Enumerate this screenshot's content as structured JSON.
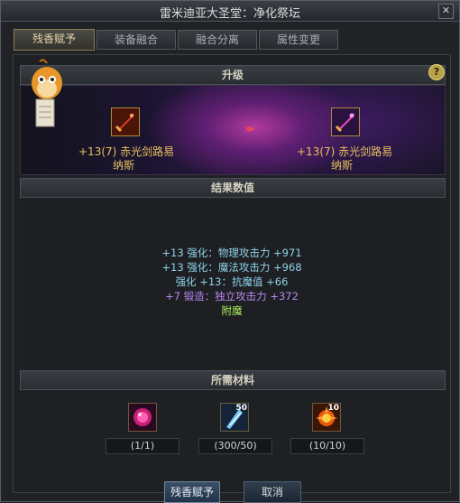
{
  "window": {
    "title": "雷米迪亚大圣堂：净化祭坛"
  },
  "tabs": [
    {
      "label": "残香赋予"
    },
    {
      "label": "装备融合"
    },
    {
      "label": "融合分离"
    },
    {
      "label": "属性变更"
    }
  ],
  "upgrade": {
    "header": "升级",
    "source_item": {
      "level": "+13(7)",
      "name_line1": "赤光剑路易",
      "name_line2": "纳斯"
    },
    "target_item": {
      "level": "+13(7)",
      "name_line1": "赤光剑路易",
      "name_line2": "纳斯"
    },
    "arrows": "›››"
  },
  "results": {
    "header": "结果数值",
    "lines": [
      {
        "text": "+13 强化：物理攻击力 +971",
        "color": "#8fd3e8"
      },
      {
        "text": "+13 强化：魔法攻击力 +968",
        "color": "#8fd3e8"
      },
      {
        "text": "强化 +13：抗魔值 +66",
        "color": "#8fd3e8"
      },
      {
        "text": "+7 锻造：独立攻击力 +372",
        "color": "#b689f0"
      },
      {
        "text": "附魔",
        "color": "#a8f05a"
      }
    ]
  },
  "materials": {
    "header": "所需材料",
    "items": [
      {
        "icon": "pink-orb-icon",
        "badge": "",
        "count": "(1/1)"
      },
      {
        "icon": "crystal-shard-icon",
        "badge": "50",
        "count": "(300/50)"
      },
      {
        "icon": "fire-burst-icon",
        "badge": "10",
        "count": "(10/10)"
      }
    ]
  },
  "buttons": {
    "confirm": "残香赋予",
    "cancel": "取消"
  },
  "help": {
    "label": "?"
  },
  "close": {
    "label": "✕"
  }
}
